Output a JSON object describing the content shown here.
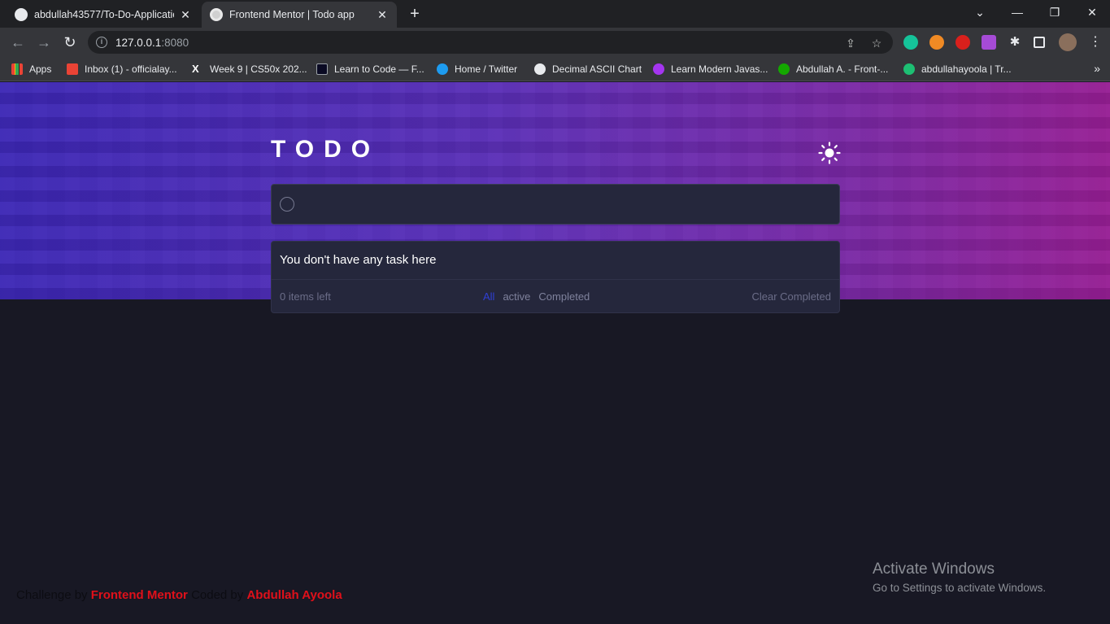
{
  "browser": {
    "tabs": [
      {
        "title": "abdullah43577/To-Do-Applicatio",
        "favicon": "github-icon",
        "active": false
      },
      {
        "title": "Frontend Mentor | Todo app",
        "favicon": "frontend-mentor-icon",
        "active": true
      }
    ],
    "url_host": "127.0.0.1",
    "url_port": ":8080",
    "bookmarks": [
      {
        "label": "Apps",
        "icon": "apps-grid-icon",
        "color": "#e8eaed"
      },
      {
        "label": "Inbox (1) - officialay...",
        "icon": "gmail-icon",
        "color": "#ea4335"
      },
      {
        "label": "Week 9 | CS50x 202...",
        "icon": "x-icon",
        "color": "#ffffff"
      },
      {
        "label": "Learn to Code — F...",
        "icon": "code-icon",
        "color": "#0a0a23"
      },
      {
        "label": "Home / Twitter",
        "icon": "twitter-icon",
        "color": "#1d9bf0"
      },
      {
        "label": "Decimal ASCII Chart",
        "icon": "globe-icon",
        "color": "#e8eaed"
      },
      {
        "label": "Learn Modern Javas...",
        "icon": "udemy-icon",
        "color": "#a435f0"
      },
      {
        "label": "Abdullah A. - Front-...",
        "icon": "upwork-icon",
        "color": "#14a800"
      },
      {
        "label": "abdullahayoola | Tr...",
        "icon": "fiverr-icon",
        "color": "#1dbf73"
      }
    ]
  },
  "app": {
    "title": "TODO",
    "input_value": "",
    "empty_message": "You don't have any task here",
    "items_left": "0 items left",
    "filters": [
      "All",
      "active",
      "Completed"
    ],
    "active_filter": "All",
    "clear_label": "Clear Completed"
  },
  "footer": {
    "challenge_prefix": "Challenge by",
    "challenge_link": "Frontend Mentor",
    "coded_prefix": "Coded by",
    "author_link": "Abdullah Ayoola"
  },
  "overlay": {
    "activate_title": "Activate Windows",
    "activate_sub": "Go to Settings to activate Windows."
  },
  "colors": {
    "accent_link": "#e0101a",
    "filter_active": "#2f3fd4",
    "card_bg": "#25273c",
    "page_bg": "#181824"
  }
}
